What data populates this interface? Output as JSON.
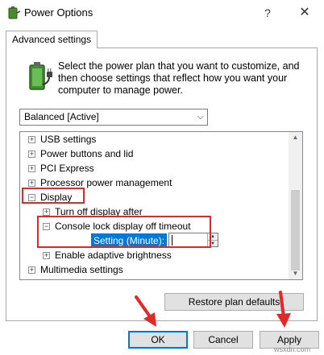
{
  "window": {
    "title": "Power Options",
    "help_glyph": "?",
    "close_glyph": "✕"
  },
  "tab": {
    "label": "Advanced settings"
  },
  "description": "Select the power plan that you want to customize, and then choose settings that reflect how you want your computer to manage power.",
  "plan_select": {
    "value": "Balanced [Active]",
    "chevron": "⌵"
  },
  "tree": {
    "items": [
      {
        "label": "USB settings",
        "toggle": "+"
      },
      {
        "label": "Power buttons and lid",
        "toggle": "+"
      },
      {
        "label": "PCI Express",
        "toggle": "+"
      },
      {
        "label": "Processor power management",
        "toggle": "+"
      },
      {
        "label": "Display",
        "toggle": "−"
      },
      {
        "label": "Turn off display after",
        "toggle": "+"
      },
      {
        "label": "Console lock display off timeout",
        "toggle": "−"
      },
      {
        "label": "Enable adaptive brightness",
        "toggle": "+"
      },
      {
        "label": "Multimedia settings",
        "toggle": "+"
      }
    ],
    "setting": {
      "label": "Setting (Minute):",
      "value": ""
    }
  },
  "buttons": {
    "restore": "Restore plan defaults",
    "ok": "OK",
    "cancel": "Cancel",
    "apply": "Apply"
  },
  "watermark": "wsxdn.com",
  "colors": {
    "selection": "#0078d7",
    "annotation": "#e02a2a"
  },
  "icons": {
    "app": "power-options-icon",
    "battery": "battery-plug-icon"
  }
}
